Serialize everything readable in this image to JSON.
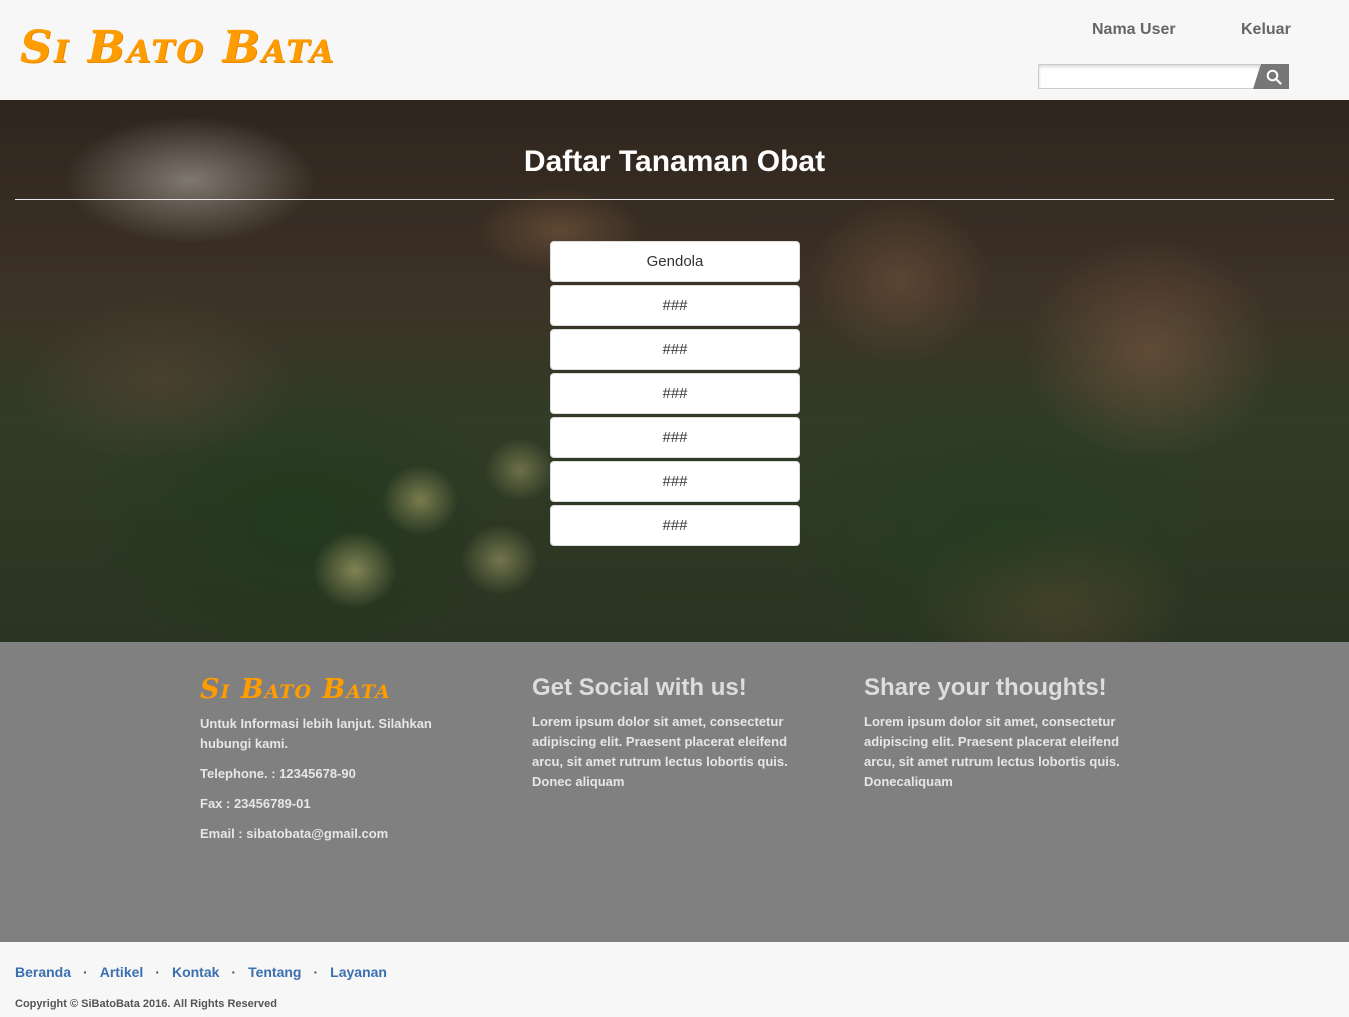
{
  "header": {
    "logo": "Si Bato Bata",
    "user_label": "Nama User",
    "logout_label": "Keluar",
    "search_placeholder": "",
    "search_value": ""
  },
  "hero": {
    "title": "Daftar Tanaman Obat",
    "items": [
      "Gendola",
      "###",
      "###",
      "###",
      "###",
      "###",
      "###"
    ]
  },
  "footer": {
    "logo": "Si Bato Bata",
    "info": "Untuk Informasi lebih lanjut. Silahkan hubungi kami.",
    "telephone": "Telephone. : 12345678-90",
    "fax": "Fax : 23456789-01",
    "email": "Email : sibatobata@gmail.com",
    "social_heading": "Get Social with us!",
    "social_text": "Lorem ipsum dolor sit amet, consectetur adipiscing elit. Praesent placerat eleifend arcu, sit amet rutrum lectus lobortis quis. Donec aliquam",
    "thoughts_heading": "Share your thoughts!",
    "thoughts_text": "Lorem ipsum dolor sit amet, consectetur adipiscing elit. Praesent placerat eleifend arcu, sit amet rutrum lectus lobortis quis. Donecaliquam"
  },
  "bottom": {
    "links": [
      "Beranda",
      "Artikel",
      "Kontak",
      "Tentang",
      "Layanan"
    ],
    "copyright": "Copyright © SiBatoBata 2016. All Rights Reserved"
  },
  "colors": {
    "brand_orange": "#ff9c00",
    "footer_gray": "#808080",
    "link_blue": "#3a6fb0"
  },
  "icons": {
    "search": "search-icon"
  }
}
